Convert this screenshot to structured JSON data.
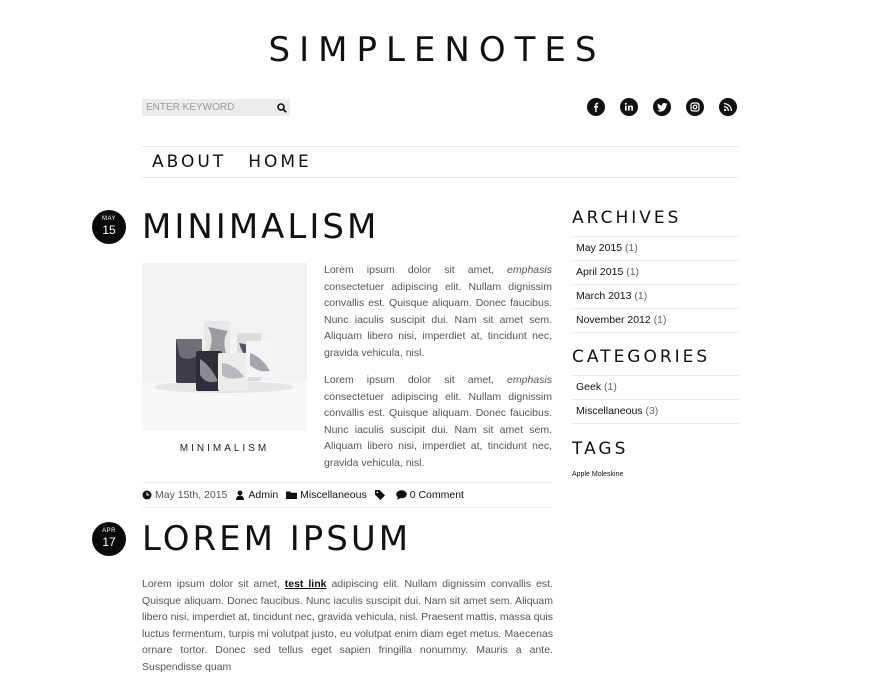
{
  "site": {
    "title": "SIMPLENOTES"
  },
  "search": {
    "placeholder": "ENTER KEYWORD"
  },
  "social": [
    "facebook-icon",
    "linkedin-icon",
    "twitter-icon",
    "instagram-icon",
    "rss-icon"
  ],
  "nav": {
    "items": [
      "ABOUT",
      "HOME"
    ]
  },
  "posts": [
    {
      "month": "MAY",
      "day": "15",
      "title": "MINIMALISM",
      "image_caption": "MINIMALISM",
      "paragraphs": [
        {
          "intro": "Lorem ipsum dolor sit amet,",
          "emphasis": "emphasis",
          "rest": "consectetuer adipiscing elit. Nullam dignissim convallis est. Quisque aliquam. Donec faucibus. Nunc iaculis suscipit dui. Nam sit amet sem. Aliquam libero nisi, imperdiet at, tincidunt nec, gravida vehicula, nisl."
        },
        {
          "intro": "Lorem ipsum dolor sit amet,",
          "emphasis": "emphasis",
          "rest": "consectetuer adipiscing elit. Nullam dignissim convallis est. Quisque aliquam. Donec faucibus. Nunc iaculis suscipit dui. Nam sit amet sem. Aliquam libero nisi, imperdiet at, tincidunt nec, gravida vehicula, nisl."
        }
      ],
      "meta": {
        "date": "May 15th, 2015",
        "author": "Admin",
        "category": "Miscellaneous",
        "comments": "0 Comment"
      }
    },
    {
      "month": "APR",
      "day": "17",
      "title": "LOREM IPSUM",
      "text_before_link": "Lorem ipsum dolor sit amet,",
      "link_text": "test link",
      "text_after_link": "adipiscing elit. Nullam dignissim convallis est. Quisque aliquam. Donec faucibus. Nunc iaculis suscipit dui. Nam sit amet sem. Aliquam libero nisi, imperdiet at, tincidunt nec, gravida vehicula, nisl. Praesent mattis, massa quis luctus fermentum, turpis mi volutpat justo, eu volutpat enim diam eget metus. Maecenas ornare tortor. Donec sed tellus eget sapien fringilla nonummy. Mauris a ante. Suspendisse quam"
    }
  ],
  "sidebar": {
    "archives": {
      "title": "ARCHIVES",
      "items": [
        {
          "label": "May 2015",
          "count": "(1)"
        },
        {
          "label": "April 2015",
          "count": "(1)"
        },
        {
          "label": "March 2013",
          "count": "(1)"
        },
        {
          "label": "November 2012",
          "count": "(1)"
        }
      ]
    },
    "categories": {
      "title": "CATEGORIES",
      "items": [
        {
          "label": "Geek",
          "count": "(1)"
        },
        {
          "label": "Miscellaneous",
          "count": "(3)"
        }
      ]
    },
    "tags": {
      "title": "TAGS",
      "items": [
        "Apple",
        "Moleskine"
      ]
    }
  },
  "colors": {
    "text": "#111111",
    "body_text": "#555555",
    "badge": "#0a0a0a",
    "search_bg": "#ececec"
  }
}
